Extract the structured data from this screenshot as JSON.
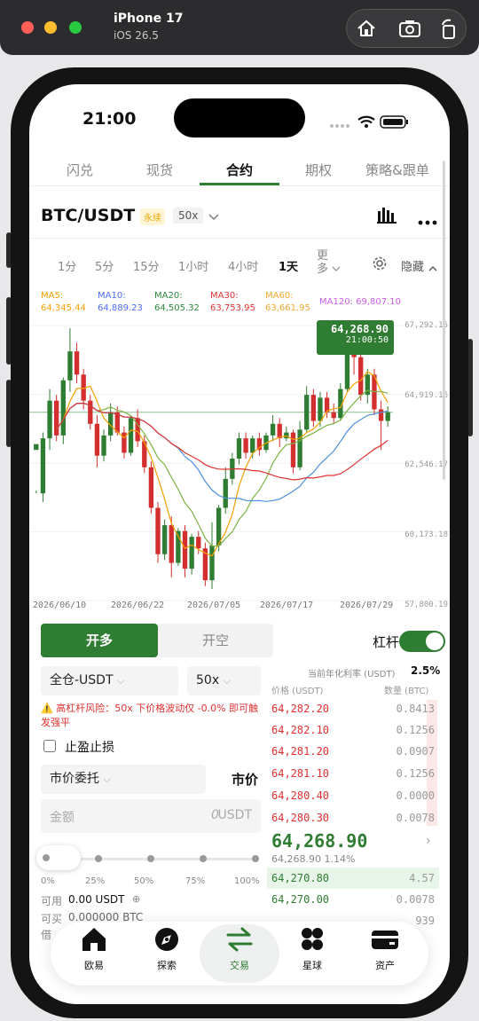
{
  "simulator": {
    "device": "iPhone 17",
    "os": "iOS 26.5"
  },
  "status": {
    "time": "21:00"
  },
  "tabs": [
    "闪兑",
    "现货",
    "合约",
    "期权",
    "策略&跟单"
  ],
  "pair": {
    "symbol": "BTC/USDT",
    "type": "永续",
    "leverage": "50x"
  },
  "timeframes": [
    "1分",
    "5分",
    "15分",
    "1小时",
    "4小时",
    "1天",
    "更多"
  ],
  "hide_label": "隐藏",
  "ma": [
    {
      "name": "MA5:",
      "value": "64,345.44",
      "color": "#f59f00"
    },
    {
      "name": "MA10:",
      "value": "64,889.23",
      "color": "#4c6ef5"
    },
    {
      "name": "MA20:",
      "value": "64,505.32",
      "color": "#2b8a3e"
    },
    {
      "name": "MA30:",
      "value": "63,753.95",
      "color": "#e03131"
    },
    {
      "name": "MA60:",
      "value": "63,661.95",
      "color": "#f0a830"
    },
    {
      "name": "MA120:",
      "value": "69,807.10",
      "color": "#cc5de8"
    }
  ],
  "chart_data": {
    "type": "candlestick",
    "y_ticks": [
      "67,292.15",
      "64,919.16",
      "62,546.17",
      "60,173.18",
      "57,800.19"
    ],
    "x_ticks": [
      "2026/06/10",
      "2026/06/22",
      "2026/07/05",
      "2026/07/17",
      "2026/07/29"
    ],
    "last_price": "64,268.90",
    "countdown": "21:00:50",
    "candles_ohlc": [
      [
        63000,
        63200,
        61600,
        61500
      ],
      [
        61500,
        63400,
        63600,
        61200
      ],
      [
        63400,
        64700,
        65100,
        63000
      ],
      [
        64700,
        63500,
        64900,
        63300
      ],
      [
        63500,
        65400,
        65500,
        63200
      ],
      [
        65400,
        66400,
        67200,
        65000
      ],
      [
        66400,
        65600,
        66700,
        65300
      ],
      [
        65600,
        64700,
        65800,
        64400
      ],
      [
        64700,
        63900,
        64900,
        63700
      ],
      [
        63900,
        62800,
        64200,
        62400
      ],
      [
        62800,
        63500,
        63700,
        62600
      ],
      [
        63500,
        64300,
        64600,
        63300
      ],
      [
        64300,
        63600,
        64500,
        63500
      ],
      [
        63600,
        62900,
        63800,
        62700
      ],
      [
        62900,
        64100,
        64200,
        62800
      ],
      [
        64100,
        63300,
        64400,
        63100
      ],
      [
        63300,
        62400,
        63500,
        62200
      ],
      [
        62400,
        61000,
        62600,
        60800
      ],
      [
        61000,
        59400,
        61200,
        59100
      ],
      [
        59400,
        60400,
        60600,
        59200
      ],
      [
        60400,
        59100,
        60700,
        58600
      ],
      [
        59100,
        60200,
        60300,
        59000
      ],
      [
        60200,
        58900,
        60400,
        58600
      ],
      [
        58900,
        60000,
        60100,
        58700
      ],
      [
        60000,
        59600,
        60200,
        59400
      ],
      [
        59600,
        58500,
        59800,
        58300
      ],
      [
        58500,
        59700,
        60500,
        58200
      ],
      [
        59700,
        61000,
        61100,
        59500
      ],
      [
        61000,
        62000,
        62400,
        60800
      ],
      [
        62000,
        62700,
        62900,
        61800
      ],
      [
        62700,
        63400,
        63600,
        62500
      ],
      [
        63400,
        62900,
        63600,
        62700
      ],
      [
        62900,
        63400,
        63500,
        62700
      ],
      [
        63400,
        63000,
        63600,
        62800
      ],
      [
        63000,
        63500,
        63600,
        62900
      ],
      [
        63500,
        63900,
        64200,
        63300
      ],
      [
        63900,
        63400,
        64100,
        63100
      ],
      [
        63400,
        63600,
        63800,
        63300
      ],
      [
        63600,
        62400,
        63700,
        62200
      ],
      [
        62400,
        63700,
        64000,
        62300
      ],
      [
        63700,
        64900,
        65200,
        63600
      ],
      [
        64900,
        64000,
        65100,
        63800
      ],
      [
        64000,
        64800,
        65000,
        63800
      ],
      [
        64800,
        64300,
        65000,
        64100
      ],
      [
        64300,
        64100,
        64600,
        63900
      ],
      [
        64100,
        65100,
        65300,
        64000
      ],
      [
        65100,
        66700,
        67100,
        65000
      ],
      [
        66700,
        66200,
        66800,
        65600
      ],
      [
        66200,
        64900,
        66400,
        64700
      ],
      [
        64900,
        65600,
        65800,
        64600
      ],
      [
        65600,
        64400,
        65800,
        64200
      ],
      [
        64400,
        64000,
        64700,
        63000
      ],
      [
        64000,
        64300,
        64500,
        63800
      ]
    ]
  },
  "order": {
    "open_long": "开多",
    "open_short": "开空",
    "leverage_label": "杠杆",
    "margin_mode": "全仓-USDT",
    "leverage": "50x",
    "warning": "⚠️ 高杠杆风险：50x 下价格波动仅 -0.0% 即可触发强平",
    "tpsl": "止盈止损",
    "order_type": "市价委托",
    "price_label": "市价",
    "amount_placeholder": "金额",
    "amount_value": "0",
    "amount_unit": "USDT",
    "slider_marks": [
      "0%",
      "25%",
      "50%",
      "75%",
      "100%"
    ],
    "available_label": "可用",
    "available_value": "0.00 USDT",
    "can_buy_label": "可买",
    "can_buy_value": "0.000000 BTC",
    "margin_label": "借"
  },
  "orderbook": {
    "funding_label": "当前年化利率 (USDT)",
    "funding_value": "2.5%",
    "price_header": "价格 (USDT)",
    "qty_header": "数量 (BTC)",
    "asks": [
      [
        "64,282.20",
        "0.8413"
      ],
      [
        "64,282.10",
        "0.1256"
      ],
      [
        "64,281.20",
        "0.0907"
      ],
      [
        "64,281.10",
        "0.1256"
      ],
      [
        "64,280.40",
        "0.0000"
      ],
      [
        "64,280.30",
        "0.0078"
      ]
    ],
    "last": "64,268.90",
    "last_sub": "64,268.90 1.14%",
    "bids": [
      [
        "64,270.80",
        "4.57"
      ],
      [
        "64,270.00",
        "0.0078"
      ],
      [
        "",
        "939"
      ]
    ]
  },
  "nav": [
    {
      "label": "欧易",
      "icon": "home-icon"
    },
    {
      "label": "探索",
      "icon": "compass-icon"
    },
    {
      "label": "交易",
      "icon": "trade-arrows-icon"
    },
    {
      "label": "星球",
      "icon": "planet-icon"
    },
    {
      "label": "资产",
      "icon": "wallet-icon"
    }
  ]
}
